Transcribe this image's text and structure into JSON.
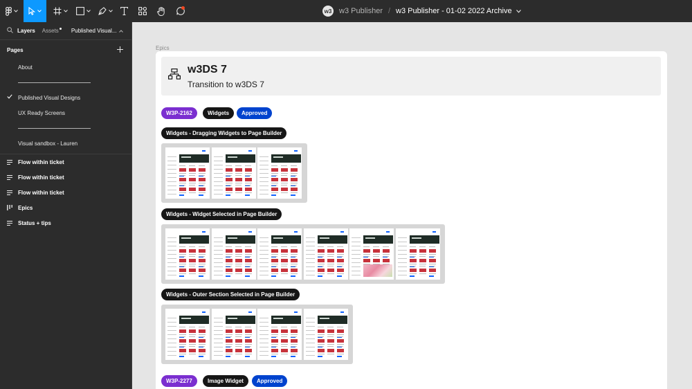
{
  "toolbar": {
    "tools": [
      {
        "name": "main-menu",
        "icon": "figma-logo-icon"
      },
      {
        "name": "move",
        "icon": "move-cursor-icon",
        "active": true
      },
      {
        "name": "frame",
        "icon": "frame-hash-icon"
      },
      {
        "name": "shape",
        "icon": "rectangle-icon"
      },
      {
        "name": "pen",
        "icon": "pen-icon"
      },
      {
        "name": "text",
        "icon": "text-icon"
      },
      {
        "name": "resources",
        "icon": "resources-icon"
      },
      {
        "name": "hand",
        "icon": "hand-icon"
      },
      {
        "name": "comment",
        "icon": "comment-icon"
      }
    ],
    "project": "w3 Publisher",
    "separator": "/",
    "file_name": "w3 Publisher - 01-02 2022 Archive",
    "accent": "#0d99ff"
  },
  "sidebar": {
    "tabs": {
      "layers": "Layers",
      "assets": "Assets",
      "page": "Published Visual..."
    },
    "pages_title": "Pages",
    "add_icon": "+",
    "pages": [
      {
        "label": "About"
      },
      {
        "divider": true
      },
      {
        "label": "Published Visual Designs",
        "current": true
      },
      {
        "label": "UX Ready Screens"
      },
      {
        "divider": true
      },
      {
        "label": "Visual sandbox - Lauren"
      }
    ],
    "layers": [
      {
        "label": "Flow within ticket",
        "icon": "lines-icon"
      },
      {
        "label": "Flow within ticket",
        "icon": "lines-icon"
      },
      {
        "label": "Flow within ticket",
        "icon": "lines-icon"
      },
      {
        "label": "Epics",
        "icon": "columns-icon"
      },
      {
        "label": "Status + tips",
        "icon": "lines-icon"
      }
    ]
  },
  "canvas": {
    "frame_label": "Epics",
    "header": {
      "title": "w3DS 7",
      "subtitle": "Transition to w3DS 7",
      "icon": "sitemap-icon"
    },
    "ticket1": {
      "id": "W3P-2162",
      "tag": "Widgets",
      "status": "Approved"
    },
    "groups": [
      {
        "label": "Widgets - Dragging Widgets to Page Builder",
        "count": 3
      },
      {
        "label": "Widgets - Widget Selected in Page Builder",
        "count": 6
      },
      {
        "label": "Widgets - Outer Section Selected in Page Builder",
        "count": 4
      }
    ],
    "thumb_title": "Page Banner Title",
    "ticket2": {
      "id": "W3P-2277",
      "tag": "Image Widget",
      "status": "Approved"
    },
    "colors": {
      "purple": "#7b2fd0",
      "black": "#161616",
      "blue": "#0043ce"
    }
  }
}
